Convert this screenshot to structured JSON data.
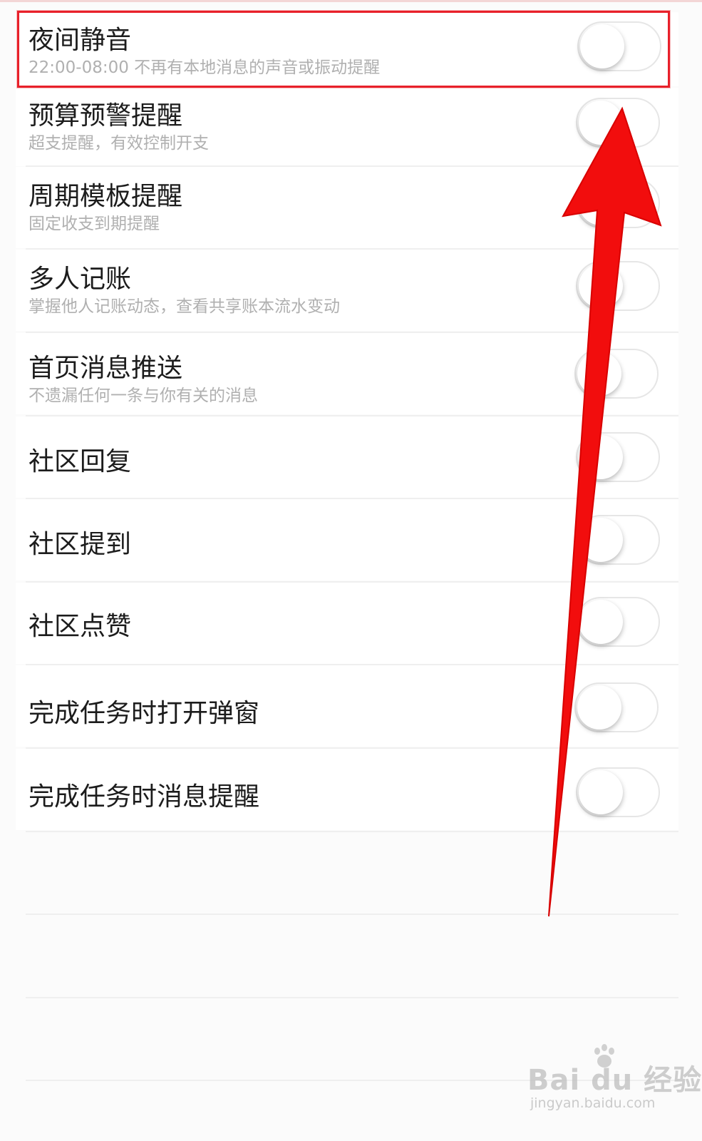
{
  "settings": [
    {
      "title": "夜间静音",
      "subtitle": "22:00-08:00 不再有本地消息的声音或振动提醒",
      "enabled": false
    },
    {
      "title": "预算预警提醒",
      "subtitle": "超支提醒，有效控制开支",
      "enabled": false
    },
    {
      "title": "周期模板提醒",
      "subtitle": "固定收支到期提醒",
      "enabled": false
    },
    {
      "title": "多人记账",
      "subtitle": "掌握他人记账动态，查看共享账本流水变动",
      "enabled": false
    },
    {
      "title": "首页消息推送",
      "subtitle": "不遗漏任何一条与你有关的消息",
      "enabled": false
    },
    {
      "title": "社区回复",
      "enabled": false
    },
    {
      "title": "社区提到",
      "enabled": false
    },
    {
      "title": "社区点赞",
      "enabled": false
    },
    {
      "title": "完成任务时打开弹窗",
      "enabled": false
    },
    {
      "title": "完成任务时消息提醒",
      "enabled": false
    }
  ],
  "annotation": {
    "highlight_color": "#e8202a",
    "arrow_color": "#f20d0d"
  },
  "watermark": {
    "brand": "Bai du 经验",
    "url": "jingyan.baidu.com"
  }
}
